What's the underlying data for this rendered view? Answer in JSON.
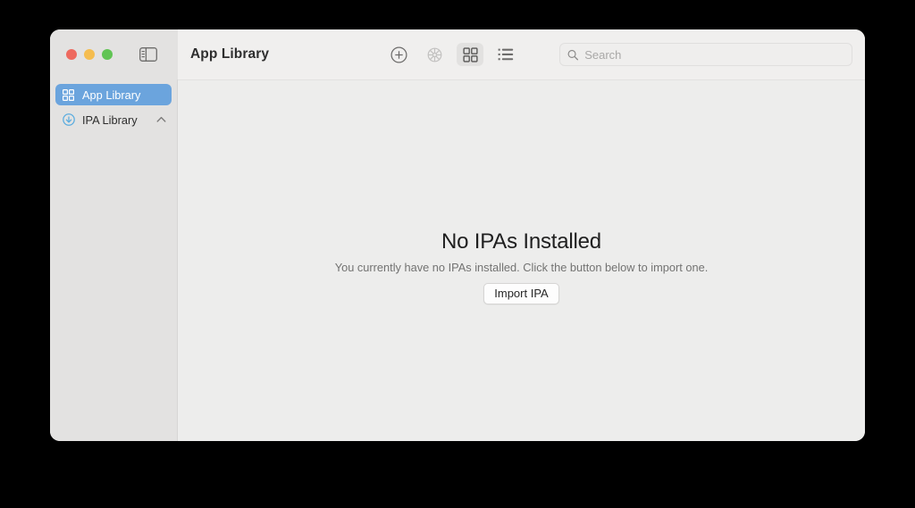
{
  "window": {
    "title": "App Library",
    "traffic_lights": [
      {
        "name": "close",
        "color": "#ee6a5f"
      },
      {
        "name": "minimize",
        "color": "#f5bd4f"
      },
      {
        "name": "maximize",
        "color": "#61c454"
      }
    ]
  },
  "toolbar": {
    "sidebar_toggle_icon": "sidebar-toggle-icon",
    "actions": [
      {
        "icon": "plus-circle-icon",
        "label": "Add",
        "selected": false,
        "disabled": false
      },
      {
        "icon": "gear-icon",
        "label": "Settings",
        "selected": false,
        "disabled": true
      },
      {
        "icon": "grid-view-icon",
        "label": "Grid View",
        "selected": true,
        "disabled": false
      },
      {
        "icon": "list-view-icon",
        "label": "List View",
        "selected": false,
        "disabled": false
      }
    ]
  },
  "search": {
    "icon": "search-icon",
    "value": "",
    "placeholder": "Search"
  },
  "sidebar": {
    "items": [
      {
        "label": "App Library",
        "icon": "grid-icon",
        "selected": true,
        "chevron": ""
      },
      {
        "label": "IPA Library",
        "icon": "download-circle-icon",
        "selected": false,
        "chevron": "chevron-up-icon"
      }
    ]
  },
  "main": {
    "empty_state": {
      "title": "No IPAs Installed",
      "subtitle": "You currently have no IPAs installed. Click the button below to import one.",
      "button_label": "Import IPA"
    }
  },
  "colors": {
    "accent": "#6ba4dd",
    "sidebar_bg": "#e3e2e1",
    "content_bg": "#ededec",
    "titlebar_bg": "#f0efee",
    "download_icon": "#5aacdf"
  }
}
